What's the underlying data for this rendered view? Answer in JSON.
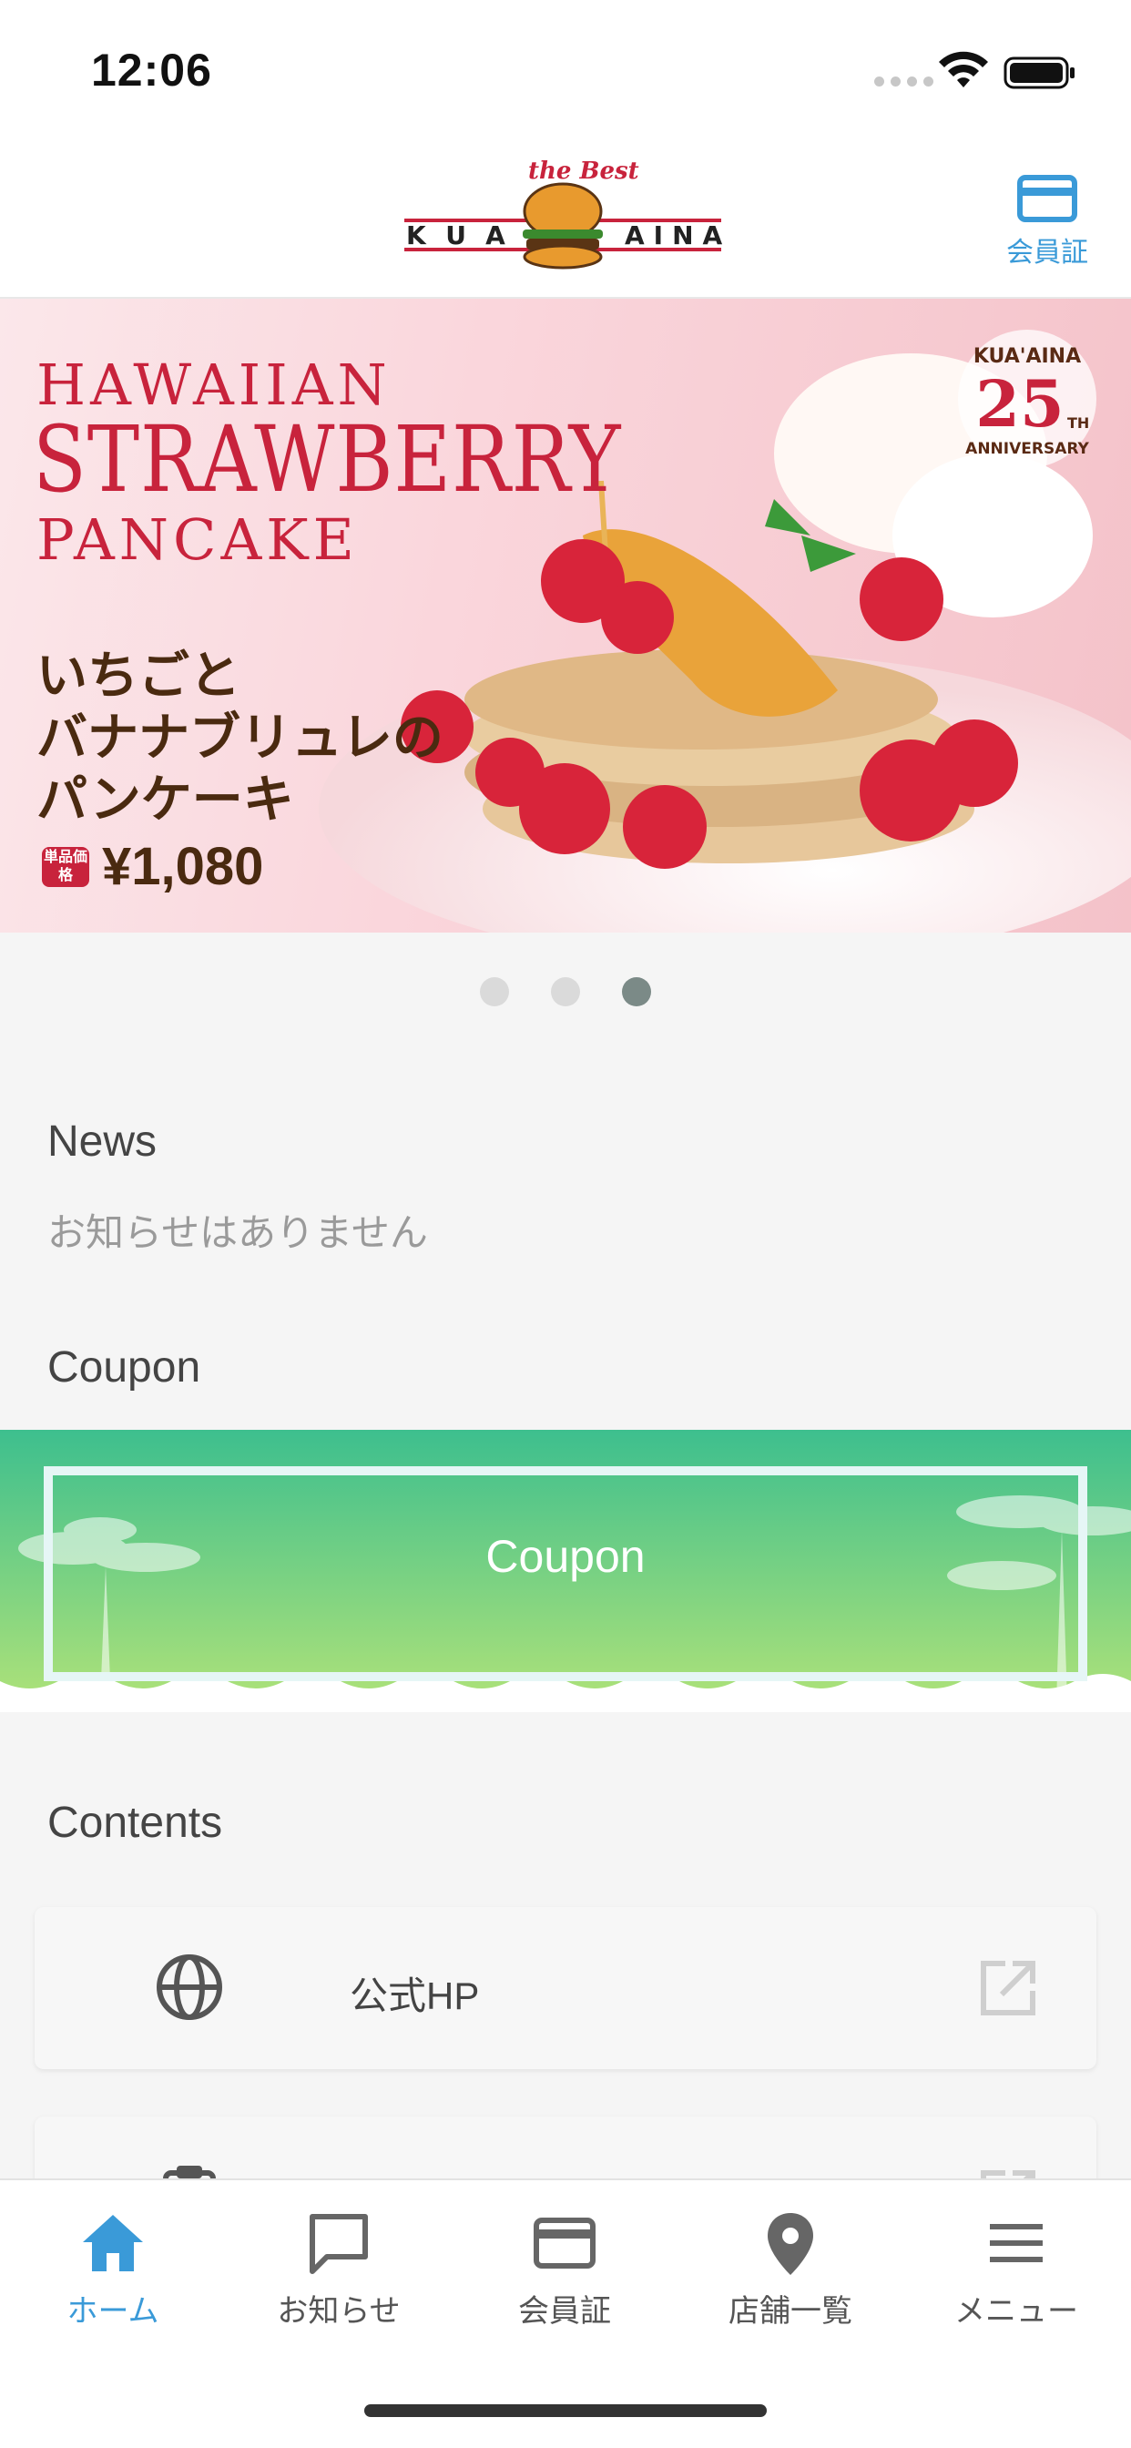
{
  "status_bar": {
    "time": "12:06"
  },
  "header": {
    "logo_text_left": "KUA",
    "logo_text_right": "AINA",
    "logo_tagline": "the Best",
    "member_label": "会員証",
    "member_icon": "card-icon"
  },
  "banner": {
    "title_line1": "HAWAIIAN",
    "title_line2": "STRAWBERRY",
    "title_line3": "PANCAKE",
    "jp_line1": "いちごと",
    "jp_line2": "バナナブリュレの",
    "jp_line3": "パンケーキ",
    "price_badge": "単品価格",
    "price": "¥1,080",
    "anniversary_brand": "KUA'AINA",
    "anniversary_number": "25",
    "anniversary_sup": "TH",
    "anniversary_text": "ANNIVERSARY",
    "pager_active_index": 2,
    "pager_count": 3
  },
  "news": {
    "title": "News",
    "empty_message": "お知らせはありません"
  },
  "coupon": {
    "title": "Coupon",
    "button_label": "Coupon"
  },
  "contents": {
    "title": "Contents",
    "items": [
      {
        "label": "公式HP",
        "icon": "globe-icon",
        "trailing_icon": "external-link-icon"
      },
      {
        "label": "",
        "icon": "clipboard-icon",
        "trailing_icon": "external-link-icon"
      }
    ]
  },
  "tab_bar": {
    "items": [
      {
        "label": "ホーム",
        "icon": "home-icon",
        "active": true
      },
      {
        "label": "お知らせ",
        "icon": "chat-icon",
        "active": false
      },
      {
        "label": "会員証",
        "icon": "card-icon",
        "active": false
      },
      {
        "label": "店舗一覧",
        "icon": "location-pin-icon",
        "active": false
      },
      {
        "label": "メニュー",
        "icon": "hamburger-menu-icon",
        "active": false
      }
    ]
  },
  "colors": {
    "accent_blue": "#3a9ad8",
    "brand_red": "#c8233c",
    "coupon_green_top": "#3dbf8e",
    "coupon_green_bottom": "#a8e07a"
  }
}
